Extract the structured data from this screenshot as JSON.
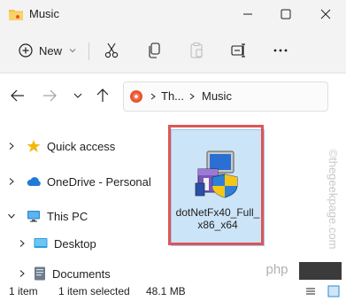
{
  "window": {
    "title": "Music"
  },
  "toolbar": {
    "new_label": "New"
  },
  "address": {
    "segments": [
      "Th...",
      "Music"
    ]
  },
  "sidebar": {
    "items": [
      {
        "label": "Quick access"
      },
      {
        "label": "OneDrive - Personal"
      },
      {
        "label": "This PC"
      },
      {
        "label": "Desktop"
      },
      {
        "label": "Documents"
      }
    ]
  },
  "file": {
    "name_line1": "dotNetFx40_Full_",
    "name_line2": "x86_x64"
  },
  "status": {
    "item_count": "1 item",
    "selected": "1 item selected",
    "size": "48.1 MB"
  },
  "watermark": {
    "text": "©thegeekpage.com"
  },
  "badge": {
    "text": "php"
  },
  "colors": {
    "accent": "#cce4f7",
    "highlight_border": "#e05555",
    "folder_blue": "#2a8bd6"
  }
}
